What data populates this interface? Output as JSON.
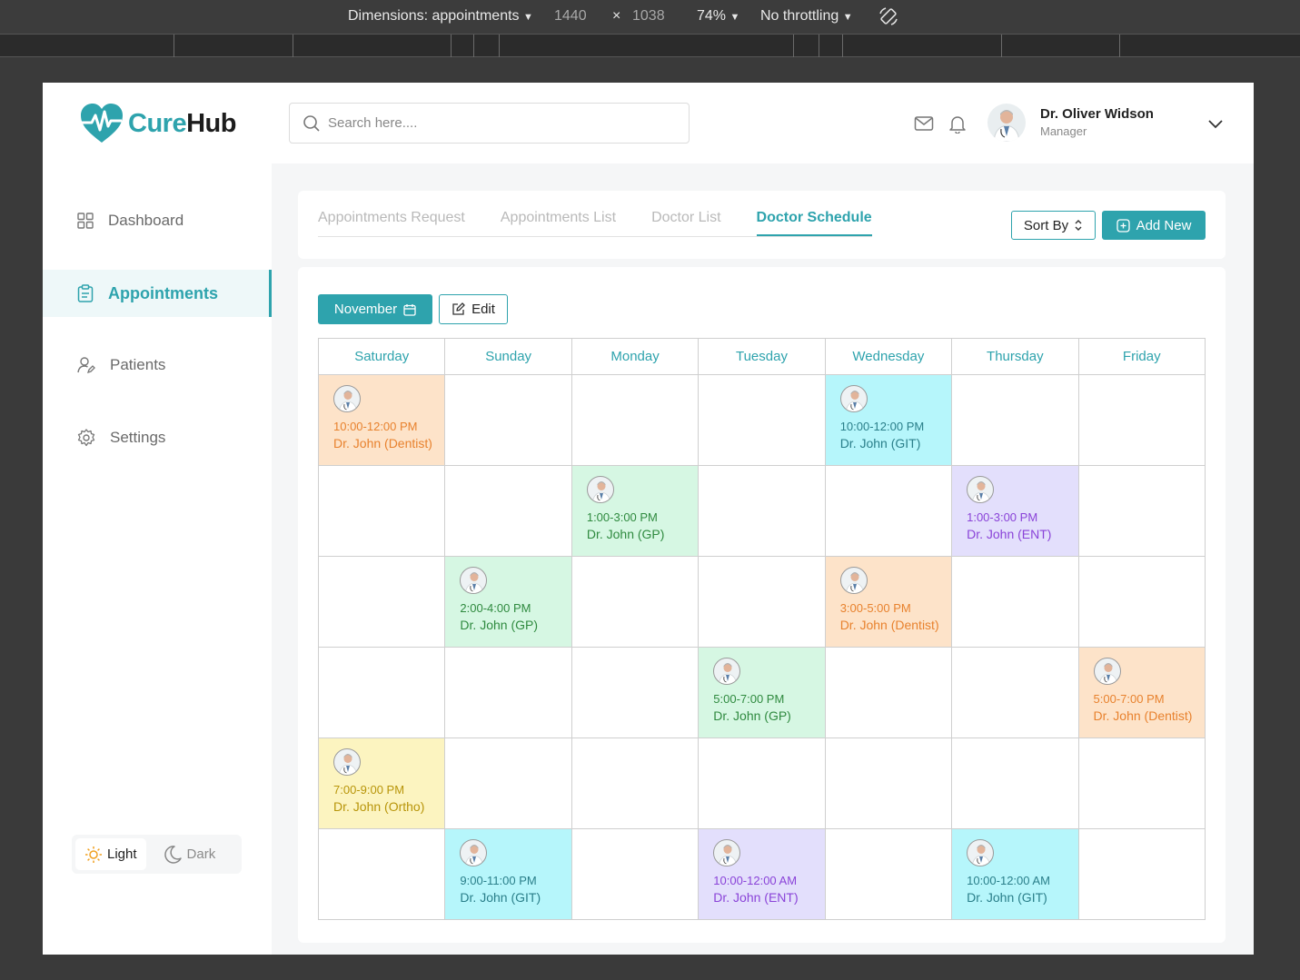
{
  "devtools": {
    "dimensions_label": "Dimensions: appointments",
    "width": "1440",
    "times": "×",
    "height": "1038",
    "zoom": "74%",
    "throttling": "No throttling"
  },
  "app": {
    "logo_part1": "Cure",
    "logo_part2": "Hub",
    "search_placeholder": "Search here....",
    "user": {
      "name": "Dr. Oliver Widson",
      "role": "Manager"
    }
  },
  "sidebar": {
    "items": [
      {
        "label": "Dashboard",
        "icon": "grid-icon"
      },
      {
        "label": "Appointments",
        "icon": "clipboard-icon",
        "active": true
      },
      {
        "label": "Patients",
        "icon": "user-edit-icon"
      },
      {
        "label": "Settings",
        "icon": "gear-icon"
      }
    ],
    "theme": {
      "light": "Light",
      "dark": "Dark"
    }
  },
  "tabs": [
    {
      "label": "Appointments Request"
    },
    {
      "label": "Appointments List"
    },
    {
      "label": "Doctor List"
    },
    {
      "label": "Doctor Schedule",
      "active": true
    }
  ],
  "actions": {
    "sort_label": "Sort By",
    "add_label": "Add New"
  },
  "schedule": {
    "month_label": "November",
    "edit_label": "Edit",
    "days": [
      "Saturday",
      "Sunday",
      "Monday",
      "Tuesday",
      "Wednesday",
      "Thursday",
      "Friday"
    ],
    "rows": [
      [
        {
          "time": "10:00-12:00 PM",
          "doctor": "Dr. John (Dentist)",
          "color": "orange"
        },
        null,
        null,
        null,
        {
          "time": "10:00-12:00 PM",
          "doctor": "Dr. John (GIT)",
          "color": "cyan"
        },
        null,
        null
      ],
      [
        null,
        null,
        {
          "time": "1:00-3:00 PM",
          "doctor": "Dr. John (GP)",
          "color": "green"
        },
        null,
        null,
        {
          "time": "1:00-3:00 PM",
          "doctor": "Dr. John (ENT)",
          "color": "purple"
        },
        null
      ],
      [
        null,
        {
          "time": "2:00-4:00 PM",
          "doctor": "Dr. John (GP)",
          "color": "green"
        },
        null,
        null,
        {
          "time": "3:00-5:00 PM",
          "doctor": "Dr. John (Dentist)",
          "color": "orange"
        },
        null,
        null
      ],
      [
        null,
        null,
        null,
        {
          "time": "5:00-7:00 PM",
          "doctor": "Dr. John (GP)",
          "color": "green"
        },
        null,
        null,
        {
          "time": "5:00-7:00 PM",
          "doctor": "Dr. John (Dentist)",
          "color": "orange"
        }
      ],
      [
        {
          "time": "7:00-9:00 PM",
          "doctor": "Dr. John (Ortho)",
          "color": "yellow"
        },
        null,
        null,
        null,
        null,
        null,
        null
      ],
      [
        null,
        {
          "time": "9:00-11:00 PM",
          "doctor": "Dr. John (GIT)",
          "color": "cyan"
        },
        null,
        {
          "time": "10:00-12:00 AM",
          "doctor": "Dr. John (ENT)",
          "color": "purple"
        },
        null,
        {
          "time": "10:00-12:00 AM",
          "doctor": "Dr. John (GIT)",
          "color": "cyan"
        },
        null
      ]
    ]
  },
  "colors": {
    "accent": "#2ea3ad",
    "orange": "#fde3c9",
    "green": "#d6f7e3",
    "cyan": "#b6f6fb",
    "purple": "#e3dffc",
    "yellow": "#fcf4c0"
  }
}
